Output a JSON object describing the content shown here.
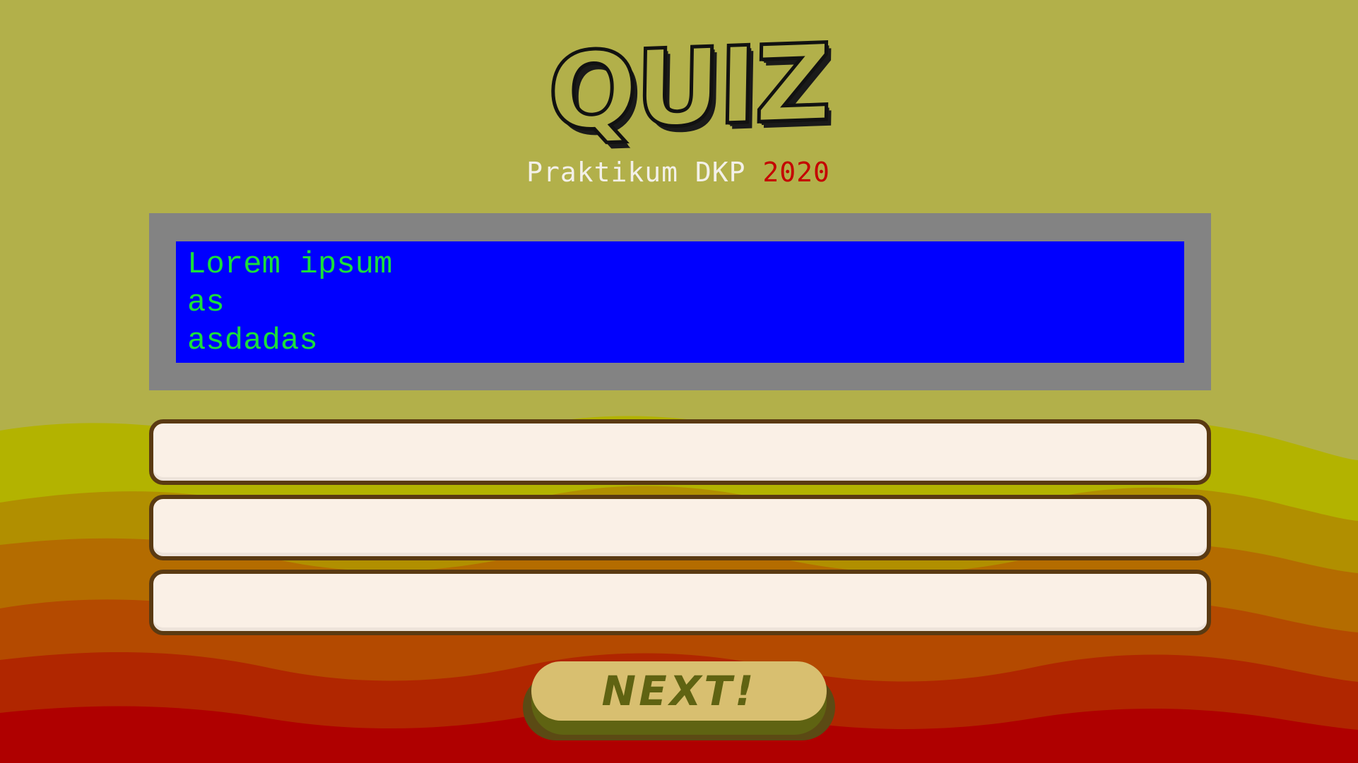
{
  "header": {
    "logo_text": "QUIZ",
    "subtitle_prefix": "Praktikum DKP",
    "subtitle_year": "2020"
  },
  "question": {
    "lines": [
      "Lorem ipsum",
      "as",
      "asdadas"
    ]
  },
  "answers": [
    {
      "value": "",
      "placeholder": ""
    },
    {
      "value": "",
      "placeholder": ""
    },
    {
      "value": "",
      "placeholder": ""
    }
  ],
  "next_button": {
    "label": "NEXT!"
  },
  "colors": {
    "background": "#b2b04a",
    "question_frame": "#838383",
    "question_bg": "#0000ff",
    "question_text": "#1adf3a",
    "answer_bg": "#faf0e6",
    "answer_border": "#5a3a12",
    "year": "#c40000",
    "button_face": "#d8bf70",
    "button_text": "#5f6312",
    "wave_bands": [
      "#b3b300",
      "#b18f00",
      "#b46c00",
      "#b44a00",
      "#b02600",
      "#af0000"
    ]
  }
}
